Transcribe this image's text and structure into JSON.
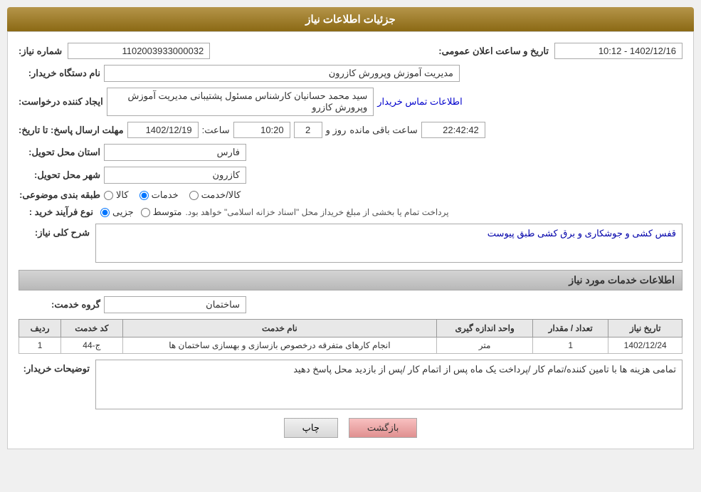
{
  "header": {
    "title": "جزئیات اطلاعات نیاز"
  },
  "fields": {
    "shomareNiaz_label": "شماره نیاز:",
    "shomareNiaz_value": "1102003933000032",
    "namDastgah_label": "نام دستگاه خریدار:",
    "namDastgah_value": "مدیریت آموزش وپرورش کازرون",
    "tarikh_label": "تاریخ و ساعت اعلان عمومی:",
    "tarikh_value": "1402/12/16 - 10:12",
    "ejadKonande_label": "ایجاد کننده درخواست:",
    "ejadKonande_value": "سید محمد  حسانیان  کارشناس مسئول پشتیبانی مدیریت آموزش وپرورش کازرو",
    "ejadKonande_link": "اطلاعات تماس خریدار",
    "mohlat_label": "مهلت ارسال پاسخ: تا تاریخ:",
    "mohlat_date": "1402/12/19",
    "mohlat_time_label": "ساعت:",
    "mohlat_time": "10:20",
    "mohlat_rooz_label": "روز و",
    "mohlat_rooz": "2",
    "mohlat_baqi_label": "ساعت باقی مانده",
    "mohlat_baqi": "22:42:42",
    "ostan_label": "استان محل تحویل:",
    "ostan_value": "فارس",
    "shahr_label": "شهر محل تحویل:",
    "shahr_value": "کازرون",
    "tabaqe_label": "طبقه بندی موضوعی:",
    "tabaqe_kala": "کالا",
    "tabaqe_khadamat": "خدمات",
    "tabaqe_kala_khadamat": "کالا/خدمت",
    "tabaqe_selected": "khadamat",
    "noeFarayand_label": "نوع فرآیند خرید :",
    "noeFarayand_jozyi": "جزیی",
    "noeFarayand_motavasset": "متوسط",
    "noeFarayand_text": "پرداخت تمام یا بخشی از مبلغ خریداز محل \"اسناد خزانه اسلامی\" خواهد بود.",
    "noeFarayand_selected": "jozyi",
    "sharhNiaz_label": "شرح کلی نیاز:",
    "sharhNiaz_value": "قفس کشی و جوشکاری و برق کشی طبق پیوست",
    "khadamat_section_title": "اطلاعات خدمات مورد نیاز",
    "groh_label": "گروه خدمت:",
    "groh_value": "ساختمان",
    "table_headers": [
      "ردیف",
      "کد خدمت",
      "نام خدمت",
      "واحد اندازه گیری",
      "تعداد / مقدار",
      "تاریخ نیاز"
    ],
    "table_rows": [
      {
        "radif": "1",
        "kod": "ج-44",
        "nam": "انجام کارهای متفرقه درخصوص بازسازی و بهسازی ساختمان ها",
        "vahed": "متر",
        "tedad": "1",
        "tarikh": "1402/12/24"
      }
    ],
    "tozih_label": "توضیحات خریدار:",
    "tozih_value": "تمامی هزینه ها با تامین کننده/تمام کار /پرداخت یک ماه پس از اتمام کار /پس از بازدید محل پاسخ دهید"
  },
  "buttons": {
    "print_label": "چاپ",
    "back_label": "بازگشت"
  }
}
